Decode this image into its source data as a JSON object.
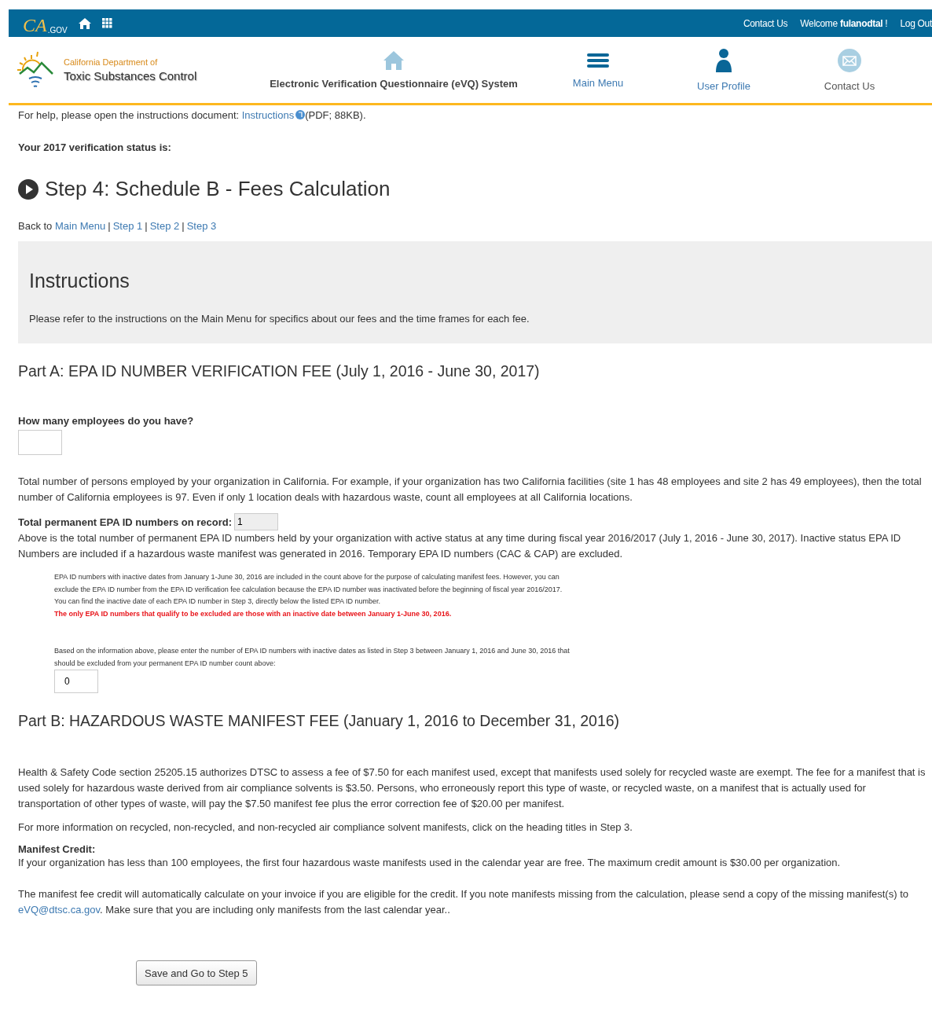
{
  "top_bar": {
    "logo_text": "CA",
    "logo_suffix": ".GOV",
    "links": [
      {
        "label": "Contact Us",
        "kind": "link"
      },
      {
        "label": "Welcome **fulanodtal** !",
        "kind": "text"
      },
      {
        "label": "Log Out",
        "kind": "link"
      }
    ]
  },
  "header": {
    "dept_line1": "California Department of",
    "dept_line2": "Toxic Substances Control",
    "system_title": "Electronic Verification Questionnaire (eVQ) System",
    "nav": [
      {
        "label": "Main Menu"
      },
      {
        "label": "User Profile"
      },
      {
        "label": "Contact Us"
      }
    ]
  },
  "help": {
    "prefix": "For help, please open the instructions document:",
    "link": "Instructions",
    "suffix": "(PDF; 88KB)."
  },
  "status_label": "Your 2017 verification status is:",
  "page_title": "Step 4: Schedule B - Fees Calculation",
  "breadcrumb": {
    "prefix": "Back to",
    "separator": "|",
    "links": [
      "Main Menu",
      "Step 1",
      "Step 2",
      "Step 3"
    ]
  },
  "instructions": {
    "title": "Instructions",
    "text": "Please refer to the instructions on the Main Menu for specifics about our fees and the time frames for each fee."
  },
  "part_a": {
    "title": "Part A: EPA ID NUMBER VERIFICATION FEE (July 1, 2016 - June 30, 2017)",
    "employees_label": "How many employees do you have?",
    "employees_help": "Total number of persons employed by your organization in California. For example, if your organization has two California facilities (site 1 has 48 employees and site 2 has 49 employees), then the total number of California employees is 97. Even if only 1 location deals with hazardous waste, count all employees at all California locations.",
    "epa_label": "Total permanent EPA ID numbers on record:",
    "epa_value": "1",
    "epa_help": "Above is the total number of permanent EPA ID numbers held by your organization with active status at any time during fiscal year 2016/2017 (July 1, 2016 - June 30, 2017). Inactive status EPA ID Numbers are included if a hazardous waste manifest was generated in 2016. Temporary EPA ID numbers (CAC & CAP) are excluded.",
    "note": "EPA ID numbers with inactive dates from January 1-June 30, 2016 are included in the count above for the purpose of calculating manifest fees. However, you can exclude the EPA ID number from the EPA ID verification fee calculation because the EPA ID number was inactivated before the beginning of fiscal year 2016/2017. You can find the inactive date of each EPA ID number in Step 3, directly below the listed EPA ID number.",
    "warning": "The only EPA ID numbers that qualify to be excluded are those with an inactive date between January 1-June 30, 2016.",
    "exclude_label": "Based on the information above, please enter the number of EPA ID numbers with inactive dates as listed in Step 3 between January 1, 2016 and June 30, 2016 that should be excluded from your permanent EPA ID number count above:",
    "exclude_value": "0"
  },
  "part_b": {
    "title": "Part B: HAZARDOUS WASTE MANIFEST FEE (January 1, 2016 to December 31, 2016)",
    "paragraph1": "Health & Safety Code section 25205.15 authorizes DTSC to assess a fee of $7.50 for each manifest used, except that manifests used solely for recycled waste are exempt. The fee for a manifest that is used solely for hazardous waste derived from air compliance solvents is $3.50. Persons, who erroneously report this type of waste, or recycled waste, on a manifest that is actually used for transportation of other types of waste, will pay the $7.50 manifest fee plus the error correction fee of $20.00 per manifest.",
    "paragraph2": "For more information on recycled, non-recycled, and non-recycled air compliance solvent manifests, click on the heading titles in Step 3.",
    "credit_title": "Manifest Credit:",
    "credit_text": "If your organization has less than 100 employees, the first four hazardous waste manifests used in the calendar year are free. The maximum credit amount is $30.00 per organization.",
    "credit_note_before": "The manifest fee credit will automatically calculate on your invoice if you are eligible for the credit. If you note manifests missing from the calculation, please send a copy of the missing manifest(s) to",
    "credit_email": "eVQ@dtsc.ca.gov",
    "credit_note_after": ". Make sure that you are including only manifests from the last calendar year.."
  },
  "save_button": "Save and Go to Step 5"
}
